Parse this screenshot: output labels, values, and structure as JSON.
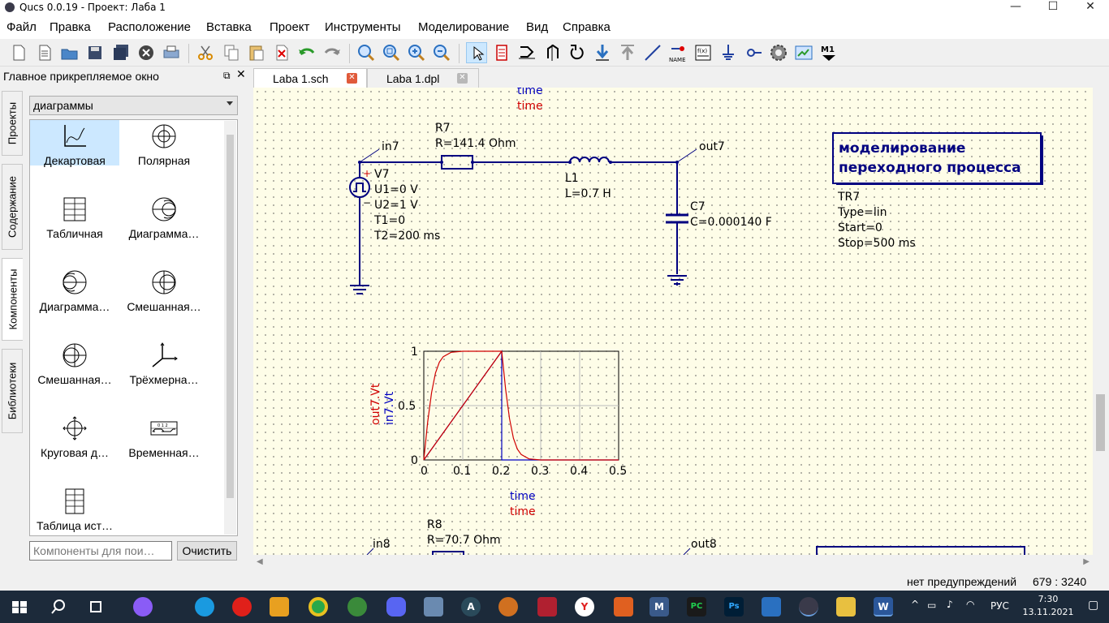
{
  "window": {
    "title": "Qucs 0.0.19 - Проект: Лаба 1",
    "minimize": "—",
    "maximize": "☐",
    "close": "✕"
  },
  "menu": [
    "Файл",
    "Правка",
    "Расположение",
    "Вставка",
    "Проект",
    "Инструменты",
    "Моделирование",
    "Вид",
    "Справка"
  ],
  "toolbar": {
    "name_label": "NAME",
    "m1_label": "M1",
    "f_label": "f(x)"
  },
  "dock": {
    "title": "Главное прикрепляемое окно",
    "float_glyph": "⧉",
    "close_glyph": "✕",
    "side_tabs": [
      "Проекты",
      "Содержание",
      "Компоненты",
      "Библиотеки"
    ],
    "category": "диаграммы",
    "components": [
      {
        "label": "Декартовая",
        "icon": "cartesian-diagram-icon"
      },
      {
        "label": "Полярная",
        "icon": "polar-diagram-icon"
      },
      {
        "label": "Табличная",
        "icon": "tabular-diagram-icon"
      },
      {
        "label": "Диаграмма…",
        "icon": "smith-chart-icon"
      },
      {
        "label": "Диаграмма…",
        "icon": "admittance-smith-icon"
      },
      {
        "label": "Смешанная…",
        "icon": "polar-smith-icon"
      },
      {
        "label": "Смешанная…",
        "icon": "smith-polar-icon"
      },
      {
        "label": "Трёхмерна…",
        "icon": "3d-cartesian-icon"
      },
      {
        "label": "Круговая д…",
        "icon": "locus-curve-icon"
      },
      {
        "label": "Временная…",
        "icon": "timing-diagram-icon"
      },
      {
        "label": "Таблица ист…",
        "icon": "truth-table-icon"
      }
    ],
    "search_placeholder": "Компоненты для пои…",
    "clear_label": "Очистить"
  },
  "tabs": [
    {
      "name": "Laba 1.sch",
      "active": true
    },
    {
      "name": "Laba 1.dpl",
      "active": false
    }
  ],
  "schematic": {
    "top_time_blue": "time",
    "top_time_red": "time",
    "circuit1": {
      "in_label": "in7",
      "out_label": "out7",
      "resistor_name": "R7",
      "resistor_value": "R=141.4 Ohm",
      "inductor_name": "L1",
      "inductor_value": "L=0.7 H",
      "capacitor_name": "C7",
      "capacitor_value": "C=0.000140 F",
      "source_plus": "+",
      "source_minus": "−",
      "source_name": "V7",
      "source_params": [
        "U1=0 V",
        "U2=1 V",
        "T1=0",
        "T2=200 ms"
      ]
    },
    "title_box": [
      "моделирование",
      "переходного процесса"
    ],
    "sim": {
      "name": "TR7",
      "params": [
        "Type=lin",
        "Start=0",
        "Stop=500 ms"
      ]
    },
    "circuit2": {
      "in_label": "in8",
      "out_label": "out8",
      "resistor_name": "R8",
      "resistor_value": "R=70.7 Ohm"
    }
  },
  "chart_data": {
    "type": "line",
    "x_ticks": [
      "0",
      "0.1",
      "0.2",
      "0.3",
      "0.4",
      "0.5"
    ],
    "y_ticks": [
      "0",
      "0.5",
      "1"
    ],
    "xlim": [
      0,
      0.5
    ],
    "ylim": [
      0,
      1
    ],
    "xlabel_blue": "time",
    "xlabel_red": "time",
    "ylabel_red": "out7.Vt",
    "ylabel_blue": "in7.Vt",
    "grid": true,
    "series": [
      {
        "name": "in7.Vt",
        "color": "#0000c0",
        "x": [
          0,
          0.2,
          0.2,
          0.5
        ],
        "y": [
          0,
          1,
          0,
          0
        ]
      },
      {
        "name": "out7.Vt",
        "color": "#d00000",
        "x": [
          0,
          0.01,
          0.02,
          0.03,
          0.04,
          0.05,
          0.07,
          0.1,
          0.15,
          0.2,
          0.21,
          0.22,
          0.23,
          0.24,
          0.25,
          0.27,
          0.3,
          0.35,
          0.5
        ],
        "y": [
          0,
          0.35,
          0.62,
          0.8,
          0.9,
          0.95,
          0.99,
          1,
          1,
          1,
          0.65,
          0.38,
          0.2,
          0.1,
          0.05,
          0.01,
          0,
          0,
          0
        ]
      },
      {
        "name": "ramp",
        "color": "#d00000",
        "x": [
          0,
          0.2
        ],
        "y": [
          0,
          1
        ]
      }
    ]
  },
  "status": {
    "warnings": "нет предупреждений",
    "coords": "679 : 3240"
  },
  "taskbar": {
    "language": "РУС",
    "time": "7:30",
    "date": "13.11.2021"
  }
}
